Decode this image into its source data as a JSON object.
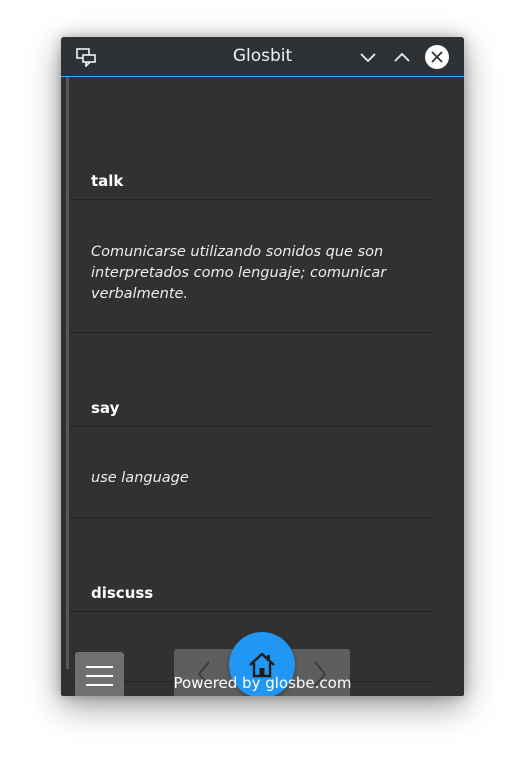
{
  "window": {
    "title": "Glosbit",
    "icons": {
      "app": "app-chat-icon",
      "minimize": "chevron-down-icon",
      "maximize": "chevron-up-icon",
      "close": "close-icon"
    },
    "accent_color": "#3daee9"
  },
  "entries": [
    {
      "term": "talk",
      "definition": "Comunicarse utilizando sonidos que son interpretados como lenguaje; comunicar verbalmente."
    },
    {
      "term": "say",
      "definition": "use language"
    },
    {
      "term": "discuss",
      "definition": ""
    }
  ],
  "controls": {
    "menu_icon": "hamburger-menu-icon",
    "back_icon": "chevron-left-icon",
    "forward_icon": "chevron-right-icon",
    "home_icon": "home-icon",
    "home_color": "#2196f3"
  },
  "footer": {
    "text": "Powered by glosbe.com"
  }
}
